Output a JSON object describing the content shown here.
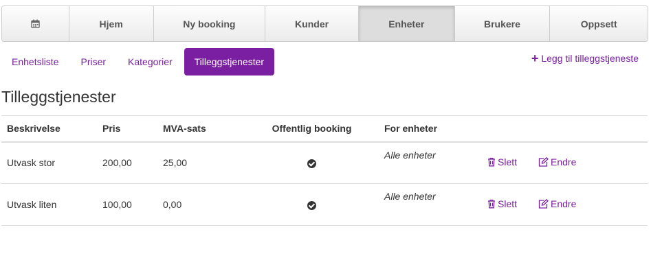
{
  "nav": {
    "items": [
      {
        "label": "",
        "icon": "calendar-icon"
      },
      {
        "label": "Hjem"
      },
      {
        "label": "Ny booking"
      },
      {
        "label": "Kunder"
      },
      {
        "label": "Enheter",
        "active": true
      },
      {
        "label": "Brukere"
      },
      {
        "label": "Oppsett"
      }
    ]
  },
  "subtabs": [
    "Enhetsliste",
    "Priser",
    "Kategorier",
    "Tilleggstjenester"
  ],
  "active_subtab": "Tilleggstjenester",
  "add_link": {
    "label": "Legg til tilleggstjeneste",
    "icon": "plus-icon"
  },
  "title": "Tilleggstjenester",
  "table": {
    "headers": [
      "Beskrivelse",
      "Pris",
      "MVA-sats",
      "Offentlig booking",
      "For enheter"
    ],
    "rows": [
      {
        "description": "Utvask stor",
        "price": "200,00",
        "vat": "25,00",
        "public": true,
        "units": "Alle enheter"
      },
      {
        "description": "Utvask liten",
        "price": "100,00",
        "vat": "0,00",
        "public": true,
        "units": "Alle enheter"
      }
    ],
    "delete_label": "Slett",
    "edit_label": "Endre"
  },
  "colors": {
    "accent": "#7b1fa2",
    "text": "#333333",
    "border": "#dddddd"
  }
}
